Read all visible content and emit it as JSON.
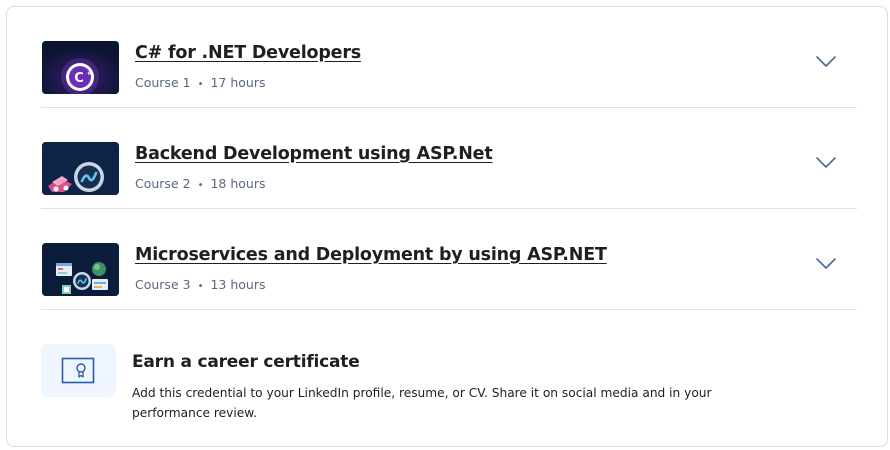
{
  "courses": [
    {
      "title": "C# for .NET Developers",
      "course_label": "Course 1",
      "duration": "17 hours",
      "thumbnail_icon": "csharp-logo-icon",
      "expand_icon": "chevron-down-icon"
    },
    {
      "title": "Backend Development using ASP.Net",
      "course_label": "Course 2",
      "duration": "18 hours",
      "thumbnail_icon": "dotnet-logo-icon",
      "expand_icon": "chevron-down-icon"
    },
    {
      "title": "Microservices and Deployment by using ASP.NET",
      "course_label": "Course 3",
      "duration": "13 hours",
      "thumbnail_icon": "microservices-illustration-icon",
      "expand_icon": "chevron-down-icon"
    }
  ],
  "separator": "•",
  "certificate": {
    "title": "Earn a career certificate",
    "description": "Add this credential to your LinkedIn profile, resume, or CV. Share it on social media and in your performance review.",
    "icon": "certificate-icon"
  },
  "colors": {
    "title_text": "#1f1f1f",
    "meta_text": "#5b6780",
    "chevron": "#4a6a9c",
    "thumbnail_bg": "#0a1530",
    "certificate_icon_bg": "#f0f6ff",
    "certificate_icon_stroke": "#2a5da8",
    "divider": "#e1e1e1",
    "card_border": "#dadce0"
  }
}
